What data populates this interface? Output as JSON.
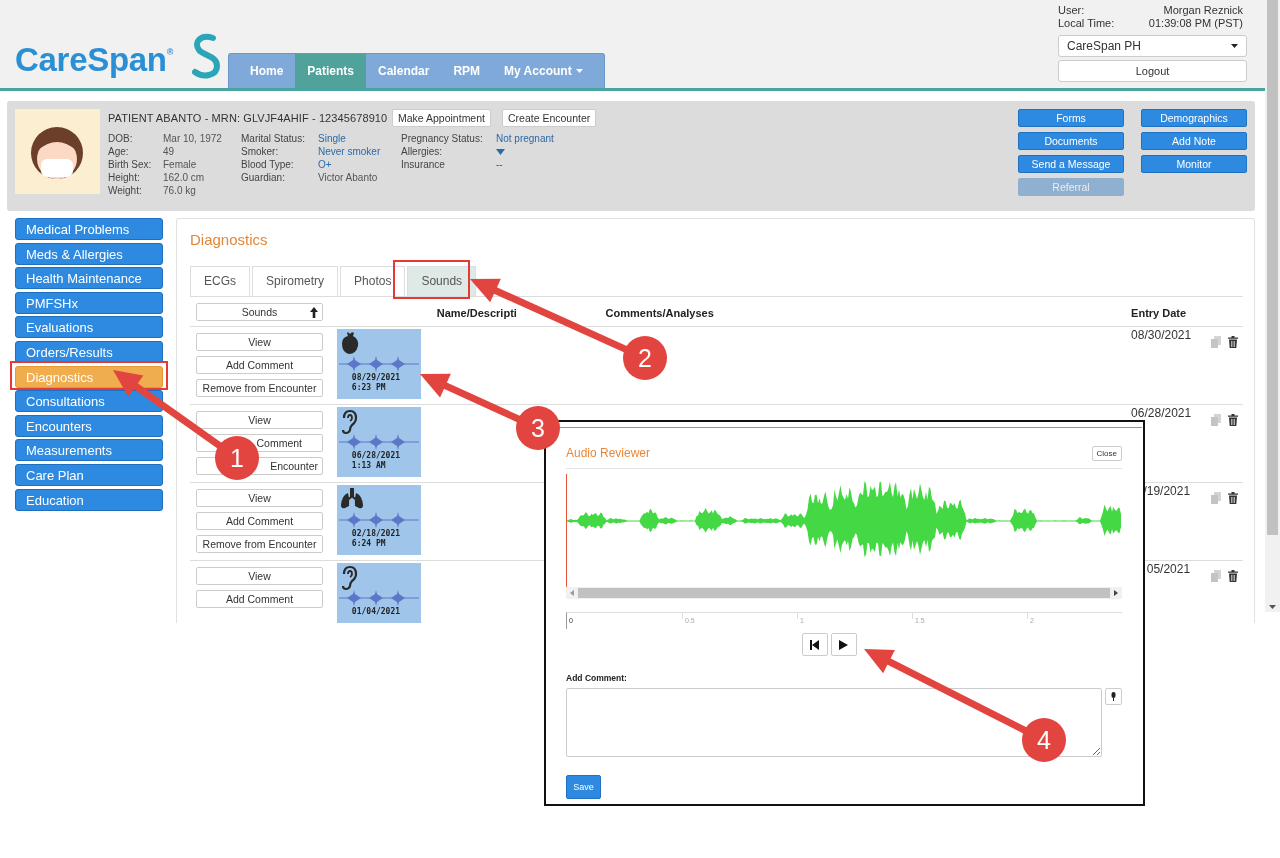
{
  "header": {
    "logo": "CareSpan$^{®}$",
    "nav": [
      {
        "label": "Home",
        "selected": false,
        "dropdown": false
      },
      {
        "label": "Patients",
        "selected": true,
        "dropdown": false
      },
      {
        "label": "Calendar",
        "selected": false,
        "dropdown": false
      },
      {
        "label": "RPM",
        "selected": false,
        "dropdown": false
      },
      {
        "label": "My Account",
        "selected": false,
        "dropdown": true
      }
    ],
    "user_label": "User:",
    "user": "Morgan Reznick",
    "time_label": "Local Time:",
    "time": "01:39:08 PM (PST)",
    "site_select": "CareSpan PH",
    "logout": "Logout"
  },
  "patient": {
    "title": "PATIENT ABANTO - MRN: GLVJF4AHIF - 12345678910",
    "actions": [
      "Make Appointment",
      "Create Encounter"
    ],
    "field_columns": [
      [
        {
          "kind": "text",
          "label": "DOB:",
          "value": "Mar 10, 1972",
          "link": false
        },
        {
          "kind": "text",
          "label": "Age:",
          "value": "49",
          "link": false
        },
        {
          "kind": "text",
          "label": "Birth Sex:",
          "value": "Female",
          "link": false
        },
        {
          "kind": "text",
          "label": "Height:",
          "value": "162.0 cm",
          "link": false
        },
        {
          "kind": "text",
          "label": "Weight:",
          "value": "76.0 kg",
          "link": false
        }
      ],
      [
        {
          "kind": "text",
          "label": "Marital Status:",
          "value": "Single",
          "link": true
        },
        {
          "kind": "text",
          "label": "Smoker:",
          "value": "Never smoker",
          "link": true
        },
        {
          "kind": "text",
          "label": "Blood Type:",
          "value": "O+",
          "link": true
        },
        {
          "kind": "text",
          "label": "Guardian:",
          "value": "Victor Abanto",
          "link": false
        }
      ],
      [
        {
          "kind": "text",
          "label": "Pregnancy Status:",
          "value": "Not pregnant",
          "link": true
        },
        {
          "kind": "toggle",
          "label": "Allergies:"
        },
        {
          "kind": "text",
          "label": "Insurance",
          "value": "--",
          "link": false
        }
      ]
    ],
    "button_columns": [
      [
        {
          "label": "Forms",
          "disabled": false
        },
        {
          "label": "Documents",
          "disabled": false
        },
        {
          "label": "Send a Message",
          "disabled": false
        },
        {
          "label": "Referral",
          "disabled": true
        }
      ],
      [
        {
          "label": "Demographics",
          "disabled": false
        },
        {
          "label": "Add Note",
          "disabled": false
        },
        {
          "label": "Monitor",
          "disabled": false
        }
      ]
    ]
  },
  "sidebar": [
    {
      "label": "Medical Problems",
      "selected": false
    },
    {
      "label": "Meds & Allergies",
      "selected": false
    },
    {
      "label": "Health Maintenance",
      "selected": false
    },
    {
      "label": "PMFSHx",
      "selected": false
    },
    {
      "label": "Evaluations",
      "selected": false
    },
    {
      "label": "Orders/Results",
      "selected": false
    },
    {
      "label": "Diagnostics",
      "selected": true
    },
    {
      "label": "Consultations",
      "selected": false
    },
    {
      "label": "Encounters",
      "selected": false
    },
    {
      "label": "Measurements",
      "selected": false
    },
    {
      "label": "Care Plan",
      "selected": false
    },
    {
      "label": "Education",
      "selected": false
    }
  ],
  "content": {
    "title": "Diagnostics",
    "tabs": [
      {
        "label": "ECGs",
        "selected": false
      },
      {
        "label": "Spirometry",
        "selected": false
      },
      {
        "label": "Photos",
        "selected": false
      },
      {
        "label": "Sounds",
        "selected": true
      }
    ],
    "sort_button": "Sounds",
    "columns": [
      "Name/Descripti",
      "Comments/Analyses",
      "Entry Date"
    ],
    "rows": [
      {
        "actions": [
          "View",
          "Add Comment",
          "Remove from Encounter"
        ],
        "sound": {
          "kind": "heart",
          "date": "08/29/2021",
          "time": "6:23 PM"
        },
        "entry_date": "08/30/2021"
      },
      {
        "actions": [
          "View",
          "Comment",
          "Encounter"
        ],
        "sound": {
          "kind": "ear",
          "date": "06/28/2021",
          "time": "1:13 AM"
        },
        "entry_date": "06/28/2021"
      },
      {
        "actions": [
          "View",
          "Add Comment",
          "Remove from Encounter"
        ],
        "sound": {
          "kind": "lungs",
          "date": "02/18/2021",
          "time": "6:24 PM"
        },
        "entry_date": "/19/2021"
      },
      {
        "actions": [
          "View",
          "Add Comment"
        ],
        "sound": {
          "kind": "ear",
          "date": "01/04/2021"
        },
        "entry_date": "05/2021"
      }
    ]
  },
  "audio_reviewer": {
    "title": "Audio Reviewer",
    "close": "Close",
    "ticks": [
      "0",
      "0.5",
      "1",
      "1.5",
      "2"
    ],
    "comment_label": "Add Comment:",
    "save": "Save"
  },
  "callouts": [
    {
      "number": "1"
    },
    {
      "number": "2"
    },
    {
      "number": "3"
    },
    {
      "number": "4"
    }
  ]
}
